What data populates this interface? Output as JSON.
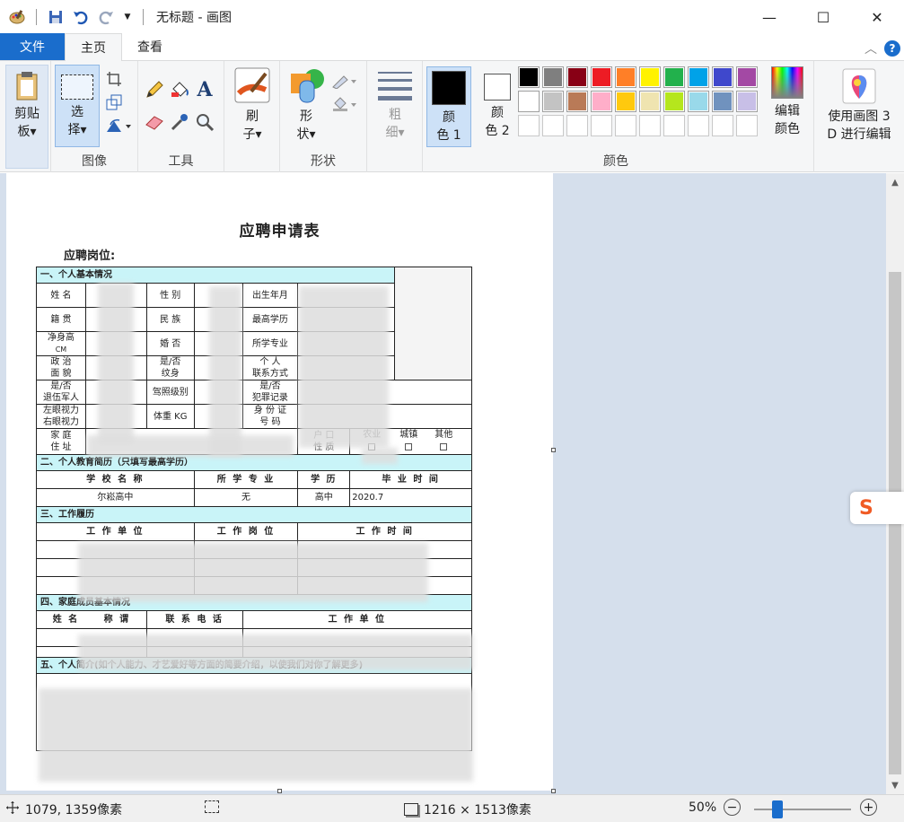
{
  "window": {
    "title": "无标题 - 画图",
    "minimize": "—",
    "maximize": "☐",
    "close": "✕"
  },
  "tabs": {
    "file": "文件",
    "home": "主页",
    "view": "查看"
  },
  "ribbon": {
    "clipboard": {
      "paste_label": "剪贴\n板▾",
      "paste_line1": "剪贴",
      "paste_line2": "板▾"
    },
    "image": {
      "select_line1": "选",
      "select_line2": "择▾",
      "group_label": "图像"
    },
    "tools": {
      "group_label": "工具"
    },
    "brushes": {
      "line1": "刷",
      "line2": "子▾"
    },
    "shapes": {
      "line1": "形",
      "line2": "状▾",
      "group_label": "形状"
    },
    "size": {
      "line1": "粗",
      "line2": "细▾"
    },
    "colors": {
      "color1_line1": "颜",
      "color1_line2": "色 1",
      "color2_line1": "颜",
      "color2_line2": "色 2",
      "edit_line1": "编辑",
      "edit_line2": "颜色",
      "paint3d_line1": "使用画图 3",
      "paint3d_line2": "D 进行编辑",
      "group_label": "颜色",
      "color1": "#000000",
      "color2": "#ffffff",
      "palette": [
        "#000000",
        "#7f7f7f",
        "#880015",
        "#ed1c24",
        "#ff7f27",
        "#fff200",
        "#22b14c",
        "#00a2e8",
        "#3f48cc",
        "#a349a4",
        "#ffffff",
        "#c3c3c3",
        "#b97a57",
        "#ffaec9",
        "#ffc90e",
        "#efe4b0",
        "#b5e61d",
        "#99d9ea",
        "#7092be",
        "#c8bfe7",
        "#ffffff",
        "#ffffff",
        "#ffffff",
        "#ffffff",
        "#ffffff",
        "#ffffff",
        "#ffffff",
        "#ffffff",
        "#ffffff",
        "#ffffff"
      ]
    }
  },
  "document": {
    "title": "应聘申请表",
    "position_label": "应聘岗位:",
    "sec1": "一、个人基本情况",
    "name": "姓  名",
    "gender": "性  别",
    "birth": "出生年月",
    "native": "籍  贯",
    "ethnic": "民  族",
    "education": "最高学历",
    "height": "净身高",
    "height_unit": "CM",
    "married": "婚  否",
    "major": "所学专业",
    "political1": "政  治",
    "political2": "面  貌",
    "tattoo1": "是/否",
    "tattoo2": "纹身",
    "contact1": "个     人",
    "contact2": "联系方式",
    "veteran1": "是/否",
    "veteran2": "退伍军人",
    "license": "驾照级别",
    "crime1": "是/否",
    "crime2": "犯罪记录",
    "vision_left": "左眼视力",
    "vision_right": "右眼视力",
    "weight": "体重 KG",
    "idcard1": "身 份 证",
    "idcard2": "号    码",
    "address1": "家  庭",
    "address2": "住  址",
    "hukou1": "户  口",
    "hukou2": "性  质",
    "farm": "农业",
    "town": "城镇",
    "other": "其他",
    "sec2": "二、个人教育简历（只填写最高学历）",
    "school_h": "学 校 名 称",
    "major_h": "所 学 专 业",
    "degree_h": "学  历",
    "grad_h": "毕 业 时 间",
    "school_v": "尔崧高中",
    "major_v": "无",
    "degree_v": "高中",
    "grad_v": "2020.7",
    "sec3": "三、工作履历",
    "work_unit": "工 作 单 位",
    "work_post": "工 作 岗 位",
    "work_time": "工 作 时  间",
    "sec4": "四、家庭成员基本情况",
    "fam_name": "姓   名",
    "fam_rel": "称 谓",
    "fam_phone": "联 系 电 话",
    "fam_unit": "工 作 单 位",
    "sec5": "五、个人简介(如个人能力、才艺爱好等方面的简要介绍，以使我们对你了解更多)"
  },
  "status": {
    "cursor": "1079, 1359像素",
    "image_size": "1216 × 1513像素",
    "zoom": "50%"
  }
}
